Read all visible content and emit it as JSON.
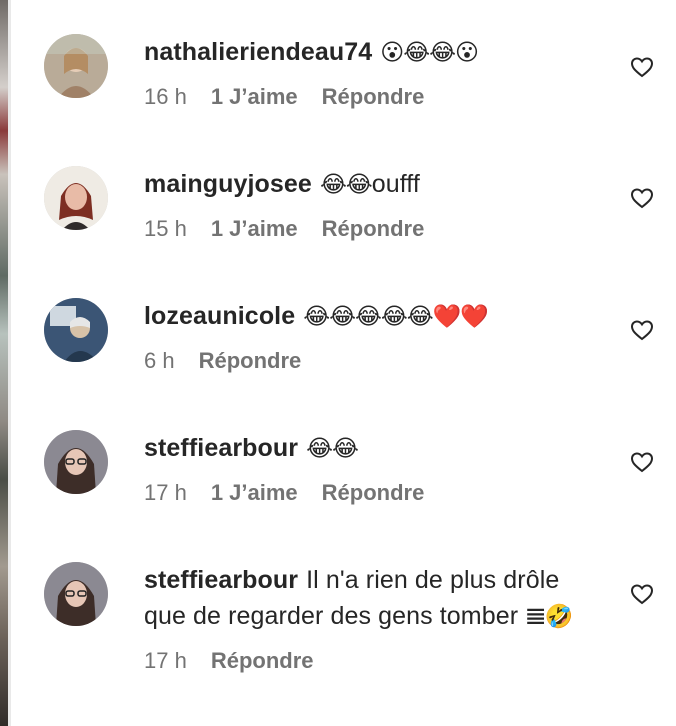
{
  "comments": [
    {
      "username": "nathalieriendeau74",
      "text": "",
      "emoji": "😮😂😂😮",
      "time": "16 h",
      "likes": "1 J’aime",
      "reply": "Répondre",
      "avatar_colors": [
        "#a49383",
        "#5b4b3a",
        "#e8d8c4"
      ]
    },
    {
      "username": "mainguyjosee",
      "text": "oufff",
      "emoji": "😂😂",
      "time": "15 h",
      "likes": "1 J’aime",
      "reply": "Répondre",
      "avatar_colors": [
        "#f0ece6",
        "#8a3a2a",
        "#e2b9a5"
      ]
    },
    {
      "username": "lozeaunicole",
      "text": "",
      "emoji": "😂😂😂😂😂❤️❤️",
      "time": "6 h",
      "likes": "",
      "reply": "Répondre",
      "avatar_colors": [
        "#2e4a68",
        "#cfd6dc",
        "#c9b08f"
      ]
    },
    {
      "username": "steffiearbour",
      "text": "",
      "emoji": "😂😂",
      "time": "17 h",
      "likes": "1 J’aime",
      "reply": "Répondre",
      "avatar_colors": [
        "#8a8892",
        "#3a2d29",
        "#e4c4b5"
      ]
    },
    {
      "username": "steffiearbour",
      "text": "Il n'a rien de plus drôle que de regarder des gens tomber ",
      "emoji": "🤣",
      "prefix_glyph": "𝌆",
      "time": "17 h",
      "likes": "",
      "reply": "Répondre",
      "avatar_colors": [
        "#8a8892",
        "#3a2d29",
        "#e4c4b5"
      ]
    }
  ],
  "icons": {
    "like": "heart-outline-icon"
  },
  "colors": {
    "text": "#262626",
    "meta": "#737373",
    "background": "#ffffff"
  }
}
